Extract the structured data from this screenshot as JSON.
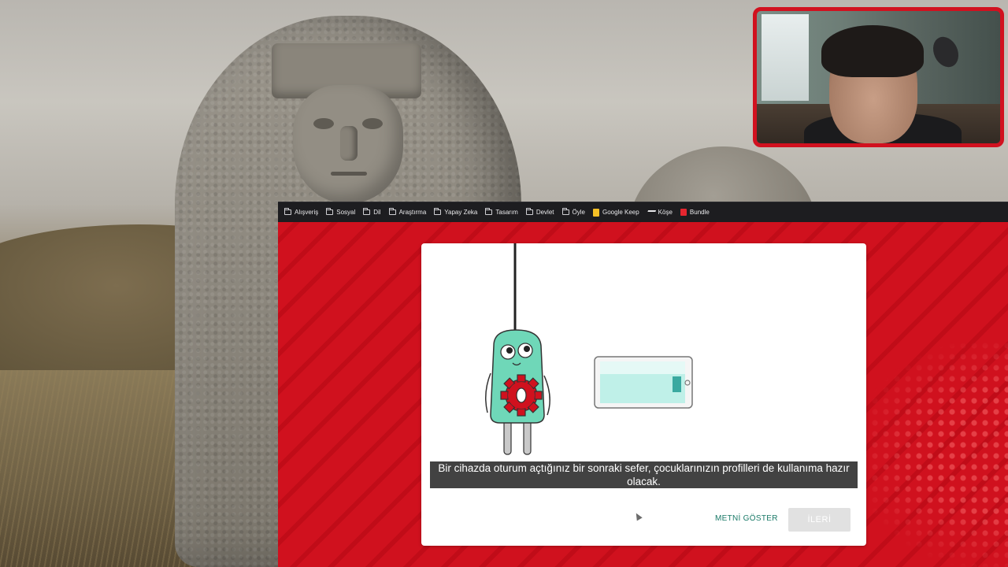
{
  "bookmarks": [
    {
      "label": "Alışveriş",
      "icon": "folder-icon"
    },
    {
      "label": "Sosyal",
      "icon": "folder-icon"
    },
    {
      "label": "Dil",
      "icon": "folder-icon"
    },
    {
      "label": "Araştırma",
      "icon": "folder-icon"
    },
    {
      "label": "Yapay Zeka",
      "icon": "folder-icon"
    },
    {
      "label": "Tasarım",
      "icon": "folder-icon"
    },
    {
      "label": "Devlet",
      "icon": "folder-icon"
    },
    {
      "label": "Öyle",
      "icon": "folder-icon"
    },
    {
      "label": "Google Keep",
      "icon": "google-keep-icon"
    },
    {
      "label": "Köşe",
      "icon": "kose-icon"
    },
    {
      "label": "Bundle",
      "icon": "bundle-icon"
    }
  ],
  "dialog": {
    "caption": "Bir cihazda oturum açtığınız bir sonraki sefer, çocuklarınızın profilleri de kullanıma hazır olacak.",
    "show_text_button": "METNİ GÖSTER",
    "next_button": "İLERİ",
    "next_enabled": false
  },
  "colors": {
    "brand_red": "#d0111e",
    "webcam_border": "#d1111f",
    "action_text": "#1a7a68",
    "mascot_green": "#6fd7b8",
    "gear_red": "#d0111e"
  }
}
